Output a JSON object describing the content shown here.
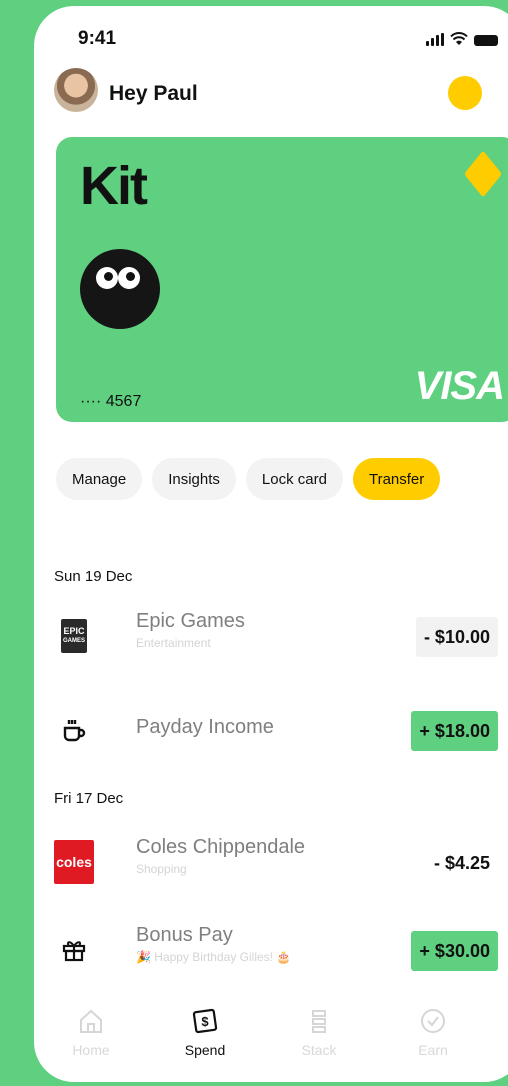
{
  "status_bar": {
    "time": "9:41"
  },
  "header": {
    "greeting": "Hey Paul"
  },
  "card": {
    "brand": "Kit",
    "number_masked": "···· 4567",
    "network": "VISA",
    "color": "#5fd07f"
  },
  "actions": [
    {
      "label": "Manage",
      "active": false
    },
    {
      "label": "Insights",
      "active": false
    },
    {
      "label": "Lock card",
      "active": false
    },
    {
      "label": "Transfer",
      "active": true
    }
  ],
  "transactions": [
    {
      "date": "Sun 19 Dec",
      "items": [
        {
          "name": "Epic Games",
          "category": "Entertainment",
          "amount": "- $10.00",
          "icon": "epic-games-icon"
        },
        {
          "name": "Payday Income",
          "category": "",
          "amount": "+ $18.00",
          "icon": "coffee-cup-icon"
        }
      ]
    },
    {
      "date": "Fri 17 Dec",
      "items": [
        {
          "name": "Coles Chippendale",
          "category": "Shopping",
          "amount": "- $4.25",
          "icon": "coles-icon"
        },
        {
          "name": "Bonus Pay",
          "category": "🎉 Happy Birthday Gilles! 🎂",
          "amount": "+ $30.00",
          "icon": "gift-icon"
        }
      ]
    }
  ],
  "tabbar": [
    {
      "label": "Home",
      "active": false,
      "icon": "home-icon"
    },
    {
      "label": "Spend",
      "active": true,
      "icon": "dollar-icon"
    },
    {
      "label": "Stack",
      "active": false,
      "icon": "stack-icon"
    },
    {
      "label": "Earn",
      "active": false,
      "icon": "check-circle-icon"
    }
  ],
  "colors": {
    "accent_green": "#5fd07f",
    "accent_yellow": "#ffcc00"
  }
}
